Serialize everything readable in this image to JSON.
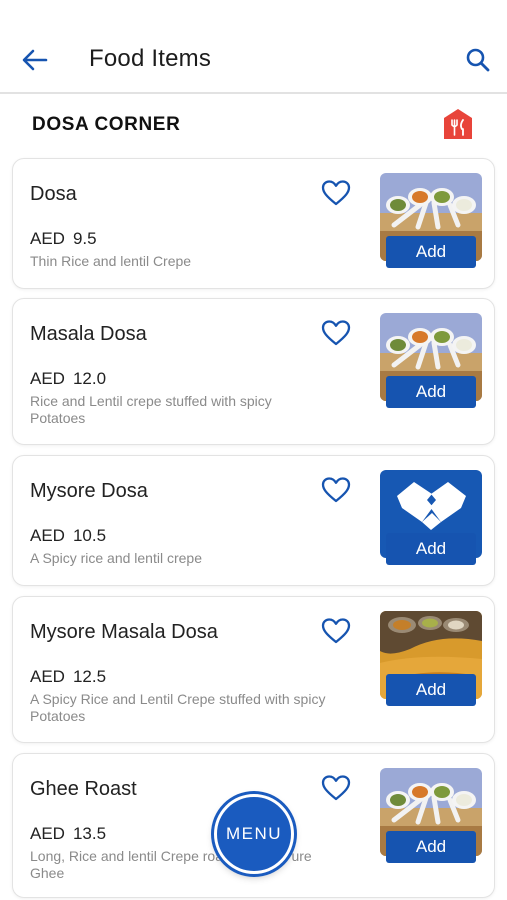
{
  "header": {
    "title": "Food Items",
    "back_icon": "arrow-left-icon",
    "search_icon": "search-icon"
  },
  "restaurant": {
    "name": "DOSA CORNER",
    "icon": "restaurant-fork-knife-icon"
  },
  "items": [
    {
      "name": "Dosa",
      "currency": "AED",
      "price": "9.5",
      "description": "Thin Rice and lentil Crepe",
      "add_label": "Add",
      "image": "chutney-bowls"
    },
    {
      "name": "Masala Dosa",
      "currency": "AED",
      "price": "12.0",
      "description": "Rice and Lentil crepe stuffed with spicy Potatoes",
      "add_label": "Add",
      "image": "chutney-bowls"
    },
    {
      "name": "Mysore Dosa",
      "currency": "AED",
      "price": "10.5",
      "description": "A Spicy rice and lentil crepe",
      "add_label": "Add",
      "image": "brand-logo"
    },
    {
      "name": "Mysore Masala Dosa",
      "currency": "AED",
      "price": "12.5",
      "description": "A Spicy Rice and Lentil Crepe stuffed with spicy Potatoes",
      "add_label": "Add",
      "image": "dosa-plate"
    },
    {
      "name": "Ghee Roast",
      "currency": "AED",
      "price": "13.5",
      "description": "Long, Rice and lentil Crepe roasted with Pure Ghee",
      "add_label": "Add",
      "image": "chutney-bowls"
    }
  ],
  "menu_button": {
    "label": "MENU"
  },
  "colors": {
    "accent": "#1654b0",
    "restaurant_icon": "#e8443a",
    "muted_text": "#8a8a8a"
  }
}
